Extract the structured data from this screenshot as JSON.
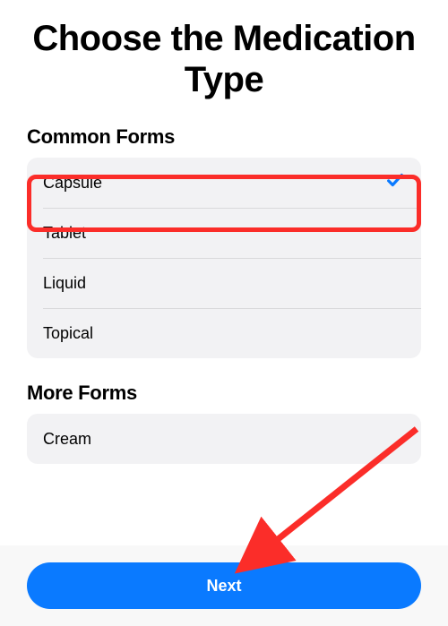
{
  "title": "Choose the Medication Type",
  "sections": {
    "common": {
      "header": "Common Forms",
      "items": [
        {
          "label": "Capsule",
          "selected": true
        },
        {
          "label": "Tablet",
          "selected": false
        },
        {
          "label": "Liquid",
          "selected": false
        },
        {
          "label": "Topical",
          "selected": false
        }
      ]
    },
    "more": {
      "header": "More Forms",
      "items": [
        {
          "label": "Cream",
          "selected": false
        }
      ]
    }
  },
  "footer": {
    "next_label": "Next"
  },
  "colors": {
    "accent": "#0a7aff",
    "highlight": "#fb2d29"
  }
}
